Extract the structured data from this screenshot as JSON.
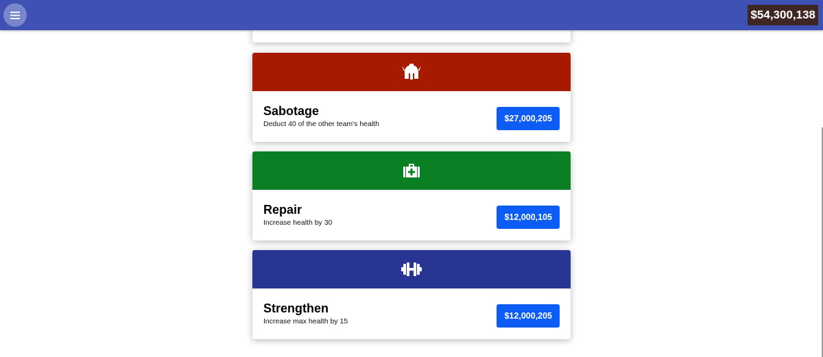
{
  "header": {
    "menu_icon": "hamburger-menu-icon",
    "balance": "$54,300,138",
    "bar_color": "#3f51b5"
  },
  "upgrades": [
    {
      "icon": "spartan-helmet-icon",
      "color": "#a61b00",
      "title": "Sabotage",
      "description": "Deduct 40 of the other team's health",
      "price": "$27,000,205"
    },
    {
      "icon": "medical-kit-icon",
      "color": "#0a7f23",
      "title": "Repair",
      "description": "Increase health by 30",
      "price": "$12,000,105"
    },
    {
      "icon": "dumbbell-icon",
      "color": "#283593",
      "title": "Strengthen",
      "description": "Increase max health by 15",
      "price": "$12,000,205"
    }
  ],
  "button_color": "#0d5cf6"
}
